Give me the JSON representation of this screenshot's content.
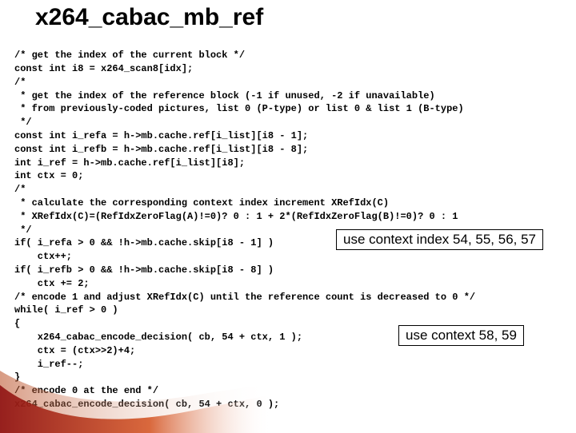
{
  "title": "x264_cabac_mb_ref",
  "code_lines": [
    "/* get the index of the current block */",
    "const int i8 = x264_scan8[idx];",
    "/*",
    " * get the index of the reference block (-1 if unused, -2 if unavailable)",
    " * from previously-coded pictures, list 0 (P-type) or list 0 & list 1 (B-type)",
    " */",
    "const int i_refa = h->mb.cache.ref[i_list][i8 - 1];",
    "const int i_refb = h->mb.cache.ref[i_list][i8 - 8];",
    "int i_ref = h->mb.cache.ref[i_list][i8];",
    "int ctx = 0;",
    "/*",
    " * calculate the corresponding context index increment XRefIdx(C)",
    " * XRefIdx(C)=(RefIdxZeroFlag(A)!=0)? 0 : 1 + 2*(RefIdxZeroFlag(B)!=0)? 0 : 1",
    " */",
    "if( i_refa > 0 && !h->mb.cache.skip[i8 - 1] )",
    "    ctx++;",
    "if( i_refb > 0 && !h->mb.cache.skip[i8 - 8] )",
    "    ctx += 2;",
    "/* encode 1 and adjust XRefIdx(C) until the reference count is decreased to 0 */",
    "while( i_ref > 0 )",
    "{",
    "    x264_cabac_encode_decision( cb, 54 + ctx, 1 );",
    "    ctx = (ctx>>2)+4;",
    "    i_ref--;",
    "}",
    "/* encode 0 at the end */",
    "x264_cabac_encode_decision( cb, 54 + ctx, 0 );"
  ],
  "callouts": {
    "c1": "use context index 54, 55, 56, 57",
    "c2": "use context 58, 59"
  }
}
